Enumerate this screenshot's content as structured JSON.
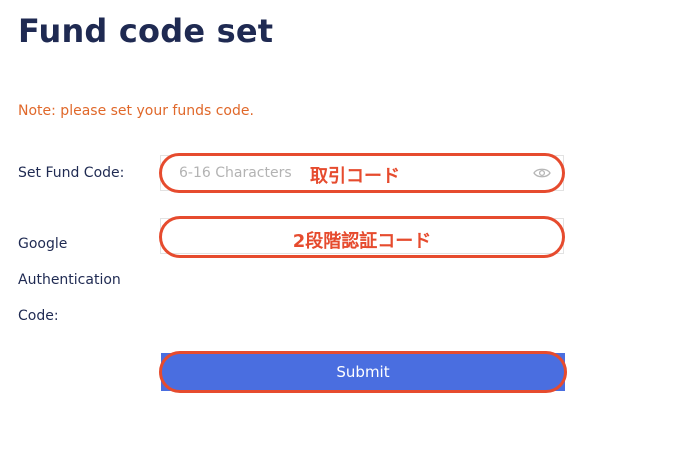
{
  "page": {
    "title": "Fund code set",
    "note": "Note: please set your funds code."
  },
  "form": {
    "fund_code_label": "Set Fund Code:",
    "fund_code_placeholder": "6-16 Characters",
    "fund_code_value": "",
    "google_label_lines": [
      "Google",
      "Authentication",
      "Code:"
    ],
    "google_code_placeholder": "",
    "google_code_value": "",
    "submit_label": "Submit"
  },
  "annotations": {
    "fund_code": "取引コード",
    "google_code": "2段階認証コード"
  },
  "icons": {
    "password_toggle": "eye-icon"
  },
  "colors": {
    "title": "#1f2a52",
    "note": "#e0682a",
    "submit_bg": "#4a6ee0",
    "annotation": "#e64b2e"
  }
}
